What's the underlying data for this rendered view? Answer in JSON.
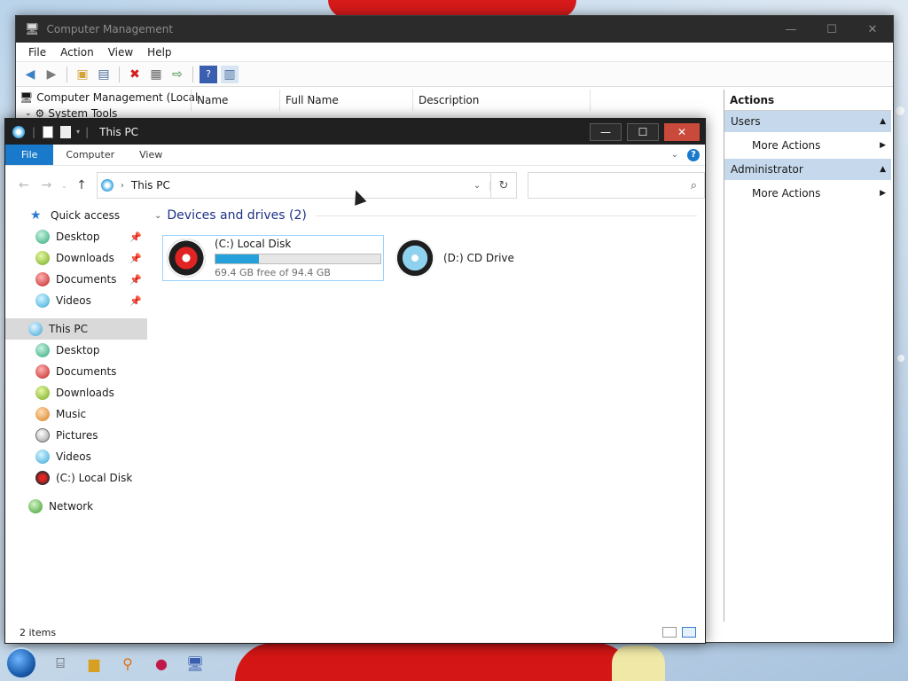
{
  "computer_management": {
    "title": "Computer Management",
    "menu": [
      "File",
      "Action",
      "View",
      "Help"
    ],
    "tree": [
      "Computer Management (Local",
      "System Tools"
    ],
    "columns": [
      "Name",
      "Full Name",
      "Description"
    ],
    "actions": {
      "title": "Actions",
      "groups": [
        {
          "label": "Users",
          "item": "More Actions"
        },
        {
          "label": "Administrator",
          "item": "More Actions"
        }
      ]
    }
  },
  "explorer": {
    "title": "This PC",
    "ribbon_tabs": [
      "File",
      "Computer",
      "View"
    ],
    "address": "This PC",
    "search_placeholder": "",
    "nav": {
      "quick_access": "Quick access",
      "quick_items": [
        "Desktop",
        "Downloads",
        "Documents",
        "Videos"
      ],
      "this_pc": "This PC",
      "pc_items": [
        "Desktop",
        "Documents",
        "Downloads",
        "Music",
        "Pictures",
        "Videos",
        "(C:) Local Disk"
      ],
      "network": "Network"
    },
    "group_title": "Devices and drives (2)",
    "drives": [
      {
        "name": "(C:) Local Disk",
        "free_text": "69.4 GB free of 94.4 GB",
        "used_fraction": 0.265
      },
      {
        "name": "(D:) CD Drive"
      }
    ],
    "status": "2 items"
  },
  "colors": {
    "accent": "#1979ca",
    "selection": "#99d1ff",
    "close": "#c94a3a"
  }
}
